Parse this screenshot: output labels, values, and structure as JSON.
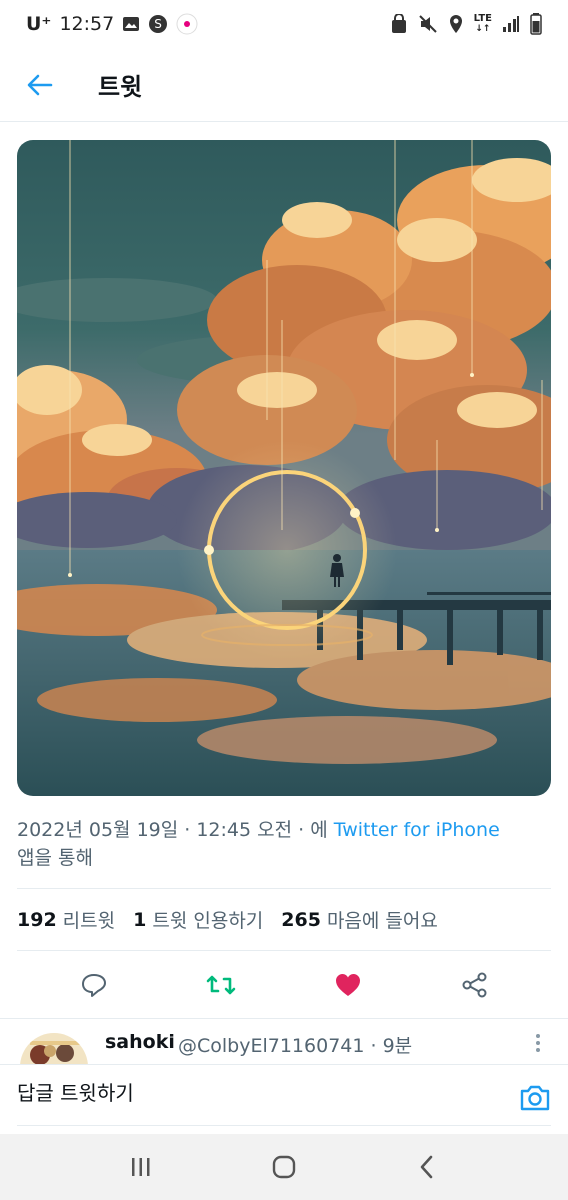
{
  "status_bar": {
    "carrier": "U⁺",
    "time": "12:57",
    "network": "LTE",
    "left_icons": [
      "image-icon",
      "s-app-icon",
      "uplus-app-icon"
    ],
    "right_icons": [
      "privacy-icon",
      "mute-icon",
      "location-icon",
      "lte-icon",
      "signal-icon",
      "battery-icon"
    ]
  },
  "header": {
    "back_icon": "arrow-left-icon",
    "title": "트윗"
  },
  "tweet": {
    "image_description_icon": "artwork-image",
    "date_text": "2022년 05월 19일 · 12:45 오전 · 에 ",
    "via": "Twitter for iPhone",
    "via_suffix": "앱을 통해",
    "stats": {
      "retweets_count": "192",
      "retweets_label": "리트윗",
      "quotes_count": "1",
      "quotes_label": "트윗 인용하기",
      "likes_count": "265",
      "likes_label": "마음에 들어요"
    },
    "actions": [
      "reply-icon",
      "retweet-icon",
      "like-icon",
      "share-icon"
    ]
  },
  "reply": {
    "name": "sahoki",
    "handle": "@ColbyEl71160741 · 9분"
  },
  "compose": {
    "placeholder": "답글 트윗하기",
    "camera_icon": "camera-icon"
  },
  "colors": {
    "accent": "#1d9bf0",
    "retweet": "#00ba7c",
    "like": "#f91880",
    "secondary_text": "#536471"
  }
}
